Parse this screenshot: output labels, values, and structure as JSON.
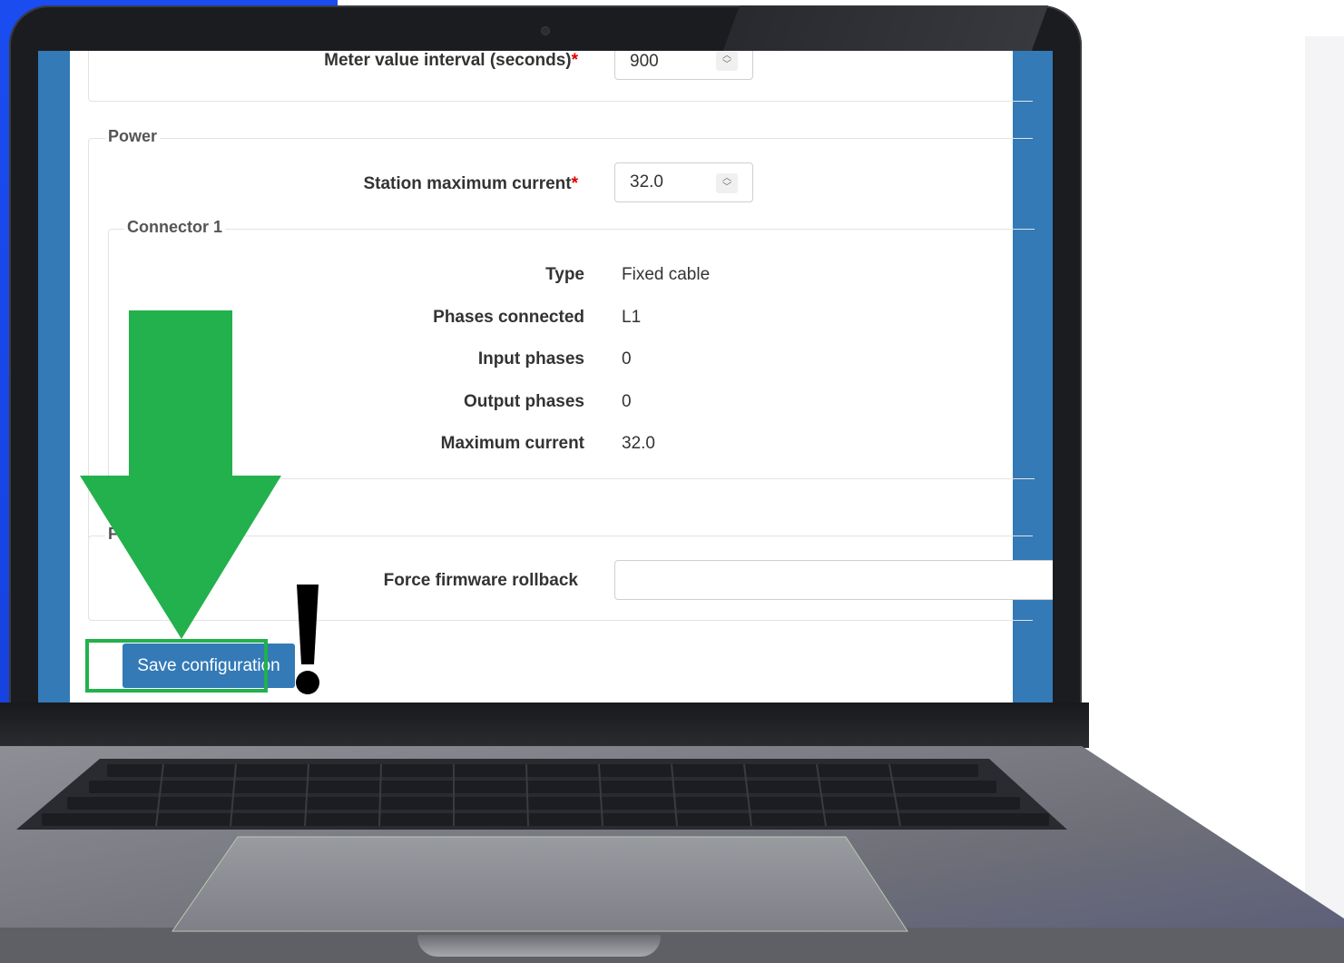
{
  "form": {
    "meter_interval": {
      "label": "Meter value interval (seconds)",
      "required_mark": "*",
      "value": "900"
    },
    "power": {
      "legend": "Power",
      "station_max_current": {
        "label": "Station maximum current",
        "required_mark": "*",
        "value": "32.0"
      },
      "connector": {
        "legend": "Connector 1",
        "rows": [
          {
            "label": "Type",
            "value": "Fixed cable"
          },
          {
            "label": "Phases connected",
            "value": "L1"
          },
          {
            "label": "Input phases",
            "value": "0"
          },
          {
            "label": "Output phases",
            "value": "0"
          },
          {
            "label": "Maximum current",
            "value": "32.0"
          }
        ]
      }
    },
    "firmware": {
      "legend_partial": "F",
      "force_rollback": {
        "label": "Force firmware rollback",
        "value": ""
      }
    },
    "save_label": "Save configuration"
  },
  "annotations": {
    "arrow_color": "#22b14c",
    "exclamation": "!"
  },
  "icons": {
    "spinner": "up-down-chevron-icon"
  }
}
